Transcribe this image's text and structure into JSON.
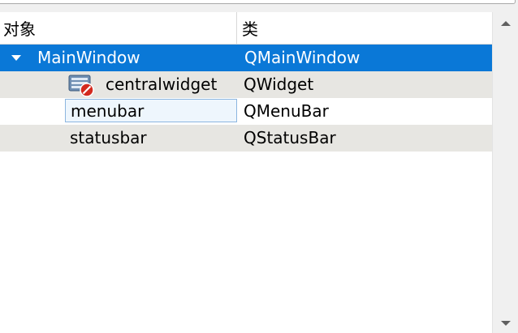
{
  "header": {
    "object_column": "对象",
    "class_column": "类"
  },
  "rows": [
    {
      "object": "MainWindow",
      "class": "QMainWindow",
      "state": "selected",
      "expanded": true
    },
    {
      "object": "centralwidget",
      "class": "QWidget",
      "icon": "layout-broken-widget-icon"
    },
    {
      "object": "menubar",
      "class": "QMenuBar",
      "editing": true
    },
    {
      "object": "statusbar",
      "class": "QStatusBar"
    }
  ],
  "colors": {
    "selection": "#0a78d7",
    "alternate_row": "#e7e6e2",
    "edit_border": "#8cb6e0"
  }
}
